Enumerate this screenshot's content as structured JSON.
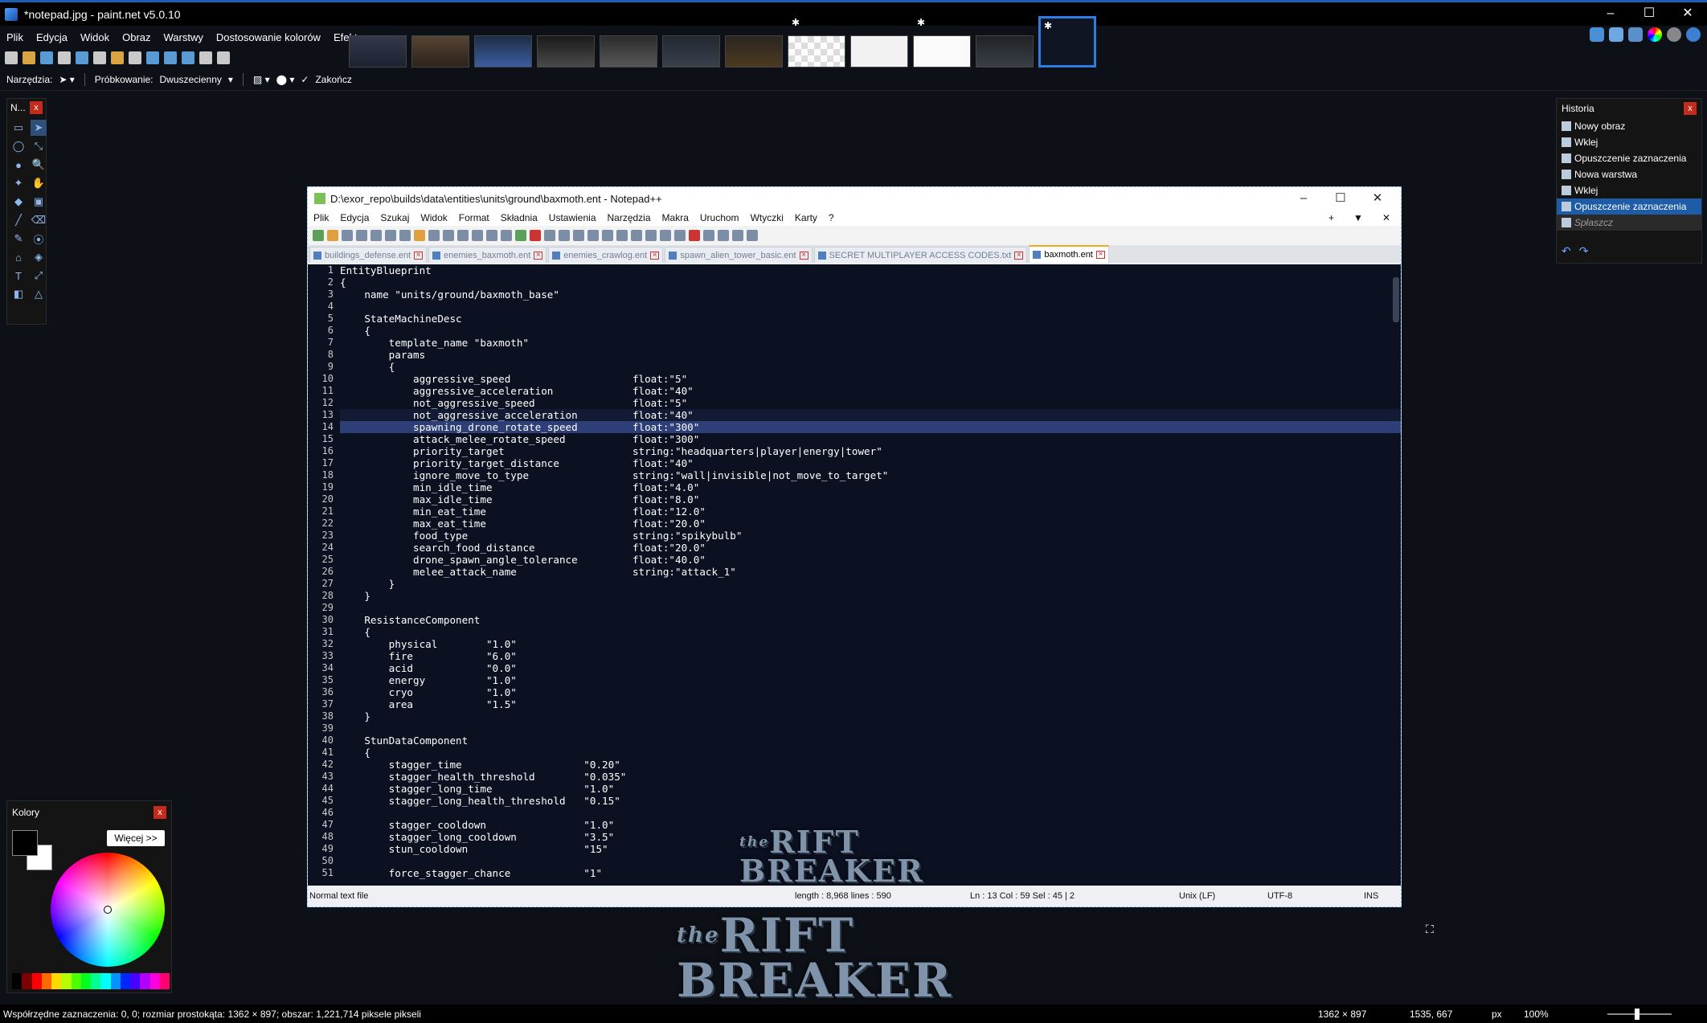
{
  "app": {
    "title": "*notepad.jpg - paint.net v5.0.10",
    "window_buttons": [
      "–",
      "☐",
      "✕"
    ]
  },
  "menu": [
    "Plik",
    "Edycja",
    "Widok",
    "Obraz",
    "Warstwy",
    "Dostosowanie kolorów",
    "Efekty"
  ],
  "toolbar2": {
    "tool_label": "Narzędzia:",
    "sampling_label": "Próbkowanie:",
    "sampling_value": "Dwuszecienny",
    "finish_label": "Zakończ"
  },
  "tools_panel": {
    "title": "N...",
    "close": "x",
    "tools": [
      "▭",
      "➤",
      "◯",
      "⤡",
      "●",
      "🔍",
      "✦",
      "✋",
      "◆",
      "▣",
      "╱",
      "⌫",
      "✎",
      "⦿",
      "⌂",
      "◈",
      "T",
      "⤢",
      "◧",
      "△"
    ]
  },
  "colors_panel": {
    "title": "Kolory",
    "close": "x",
    "more_button": "Więcej >>",
    "swatches": [
      "#000000",
      "#7f0000",
      "#ff0000",
      "#ff6a00",
      "#ffd800",
      "#b6ff00",
      "#4cff00",
      "#00ff21",
      "#00ff90",
      "#00ffff",
      "#0094ff",
      "#0026ff",
      "#4800ff",
      "#b200ff",
      "#ff00dc",
      "#ff006e"
    ]
  },
  "history_panel": {
    "title": "Historia",
    "close": "x",
    "items": [
      {
        "label": "Nowy obraz",
        "state": "normal"
      },
      {
        "label": "Wklej",
        "state": "normal"
      },
      {
        "label": "Opuszczenie zaznaczenia",
        "state": "normal"
      },
      {
        "label": "Nowa warstwa",
        "state": "normal"
      },
      {
        "label": "Wklej",
        "state": "normal"
      },
      {
        "label": "Opuszczenie zaznaczenia",
        "state": "selected"
      },
      {
        "label": "Spłaszcz",
        "state": "dim"
      }
    ]
  },
  "notepad": {
    "title": "D:\\exor_repo\\builds\\data\\entities\\units\\ground\\baxmoth.ent - Notepad++",
    "menu": [
      "Plik",
      "Edycja",
      "Szukaj",
      "Widok",
      "Format",
      "Składnia",
      "Ustawienia",
      "Narzędzia",
      "Makra",
      "Uruchom",
      "Wtyczki",
      "Karty",
      "?"
    ],
    "menu_right": [
      "+",
      "▼",
      "✕"
    ],
    "tabs": [
      {
        "label": "buildings_defense.ent",
        "active": false
      },
      {
        "label": "enemies_baxmoth.ent",
        "active": false
      },
      {
        "label": "enemies_crawlog.ent",
        "active": false
      },
      {
        "label": "spawn_alien_tower_basic.ent",
        "active": false
      },
      {
        "label": "SECRET MULTIPLAYER ACCESS CODES.txt",
        "active": false
      },
      {
        "label": "baxmoth.ent",
        "active": true
      }
    ],
    "lines": [
      "EntityBlueprint",
      "{",
      "    name \"units/ground/baxmoth_base\"",
      "",
      "    StateMachineDesc",
      "    {",
      "        template_name \"baxmoth\"",
      "        params",
      "        {",
      "            aggressive_speed                    float:\"5\"",
      "            aggressive_acceleration             float:\"40\"",
      "            not_aggressive_speed                float:\"5\"",
      "            not_aggressive_acceleration         float:\"40\"",
      "            spawning_drone_rotate_speed         float:\"300\"",
      "            attack_melee_rotate_speed           float:\"300\"",
      "            priority_target                     string:\"headquarters|player|energy|tower\"",
      "            priority_target_distance            float:\"40\"",
      "            ignore_move_to_type                 string:\"wall|invisible|not_move_to_target\"",
      "            min_idle_time                       float:\"4.0\"",
      "            max_idle_time                       float:\"8.0\"",
      "            min_eat_time                        float:\"12.0\"",
      "            max_eat_time                        float:\"20.0\"",
      "            food_type                           string:\"spikybulb\"",
      "            search_food_distance                float:\"20.0\"",
      "            drone_spawn_angle_tolerance         float:\"40.0\"",
      "            melee_attack_name                   string:\"attack_1\"",
      "        }",
      "    }",
      "",
      "    ResistanceComponent",
      "    {",
      "        physical        \"1.0\"",
      "        fire            \"6.0\"",
      "        acid            \"0.0\"",
      "        energy          \"1.0\"",
      "        cryo            \"1.0\"",
      "        area            \"1.5\"",
      "    }",
      "",
      "    StunDataComponent",
      "    {",
      "        stagger_time                    \"0.20\"",
      "        stagger_health_threshold        \"0.035\"",
      "        stagger_long_time               \"1.0\"",
      "        stagger_long_health_threshold   \"0.15\"",
      "",
      "        stagger_cooldown                \"1.0\"",
      "        stagger_long_cooldown           \"3.5\"",
      "        stun_cooldown                   \"15\"",
      "",
      "        force_stagger_chance            \"1\""
    ],
    "status": {
      "type": "Normal text file",
      "length": "length : 8,968    lines : 590",
      "pos": "Ln : 13    Col : 59    Sel : 45 | 2",
      "eol": "Unix (LF)",
      "enc": "UTF-8",
      "mode": "INS"
    }
  },
  "logo": {
    "small": "the",
    "line1": "RIFT",
    "line2": "BREAKER"
  },
  "status_bar": {
    "selection": "Współrzędne zaznaczenia: 0, 0; rozmiar prostokąta: 1362 × 897; obszar: 1,221,714 piksele pikseli",
    "image_size": "1362 × 897",
    "cursor": "1535, 667",
    "unit": "px",
    "zoom": "100%"
  },
  "colors": {
    "accent": "#2f7de1",
    "editor_bg": "#0c1121",
    "selection": "#2e3f78"
  }
}
